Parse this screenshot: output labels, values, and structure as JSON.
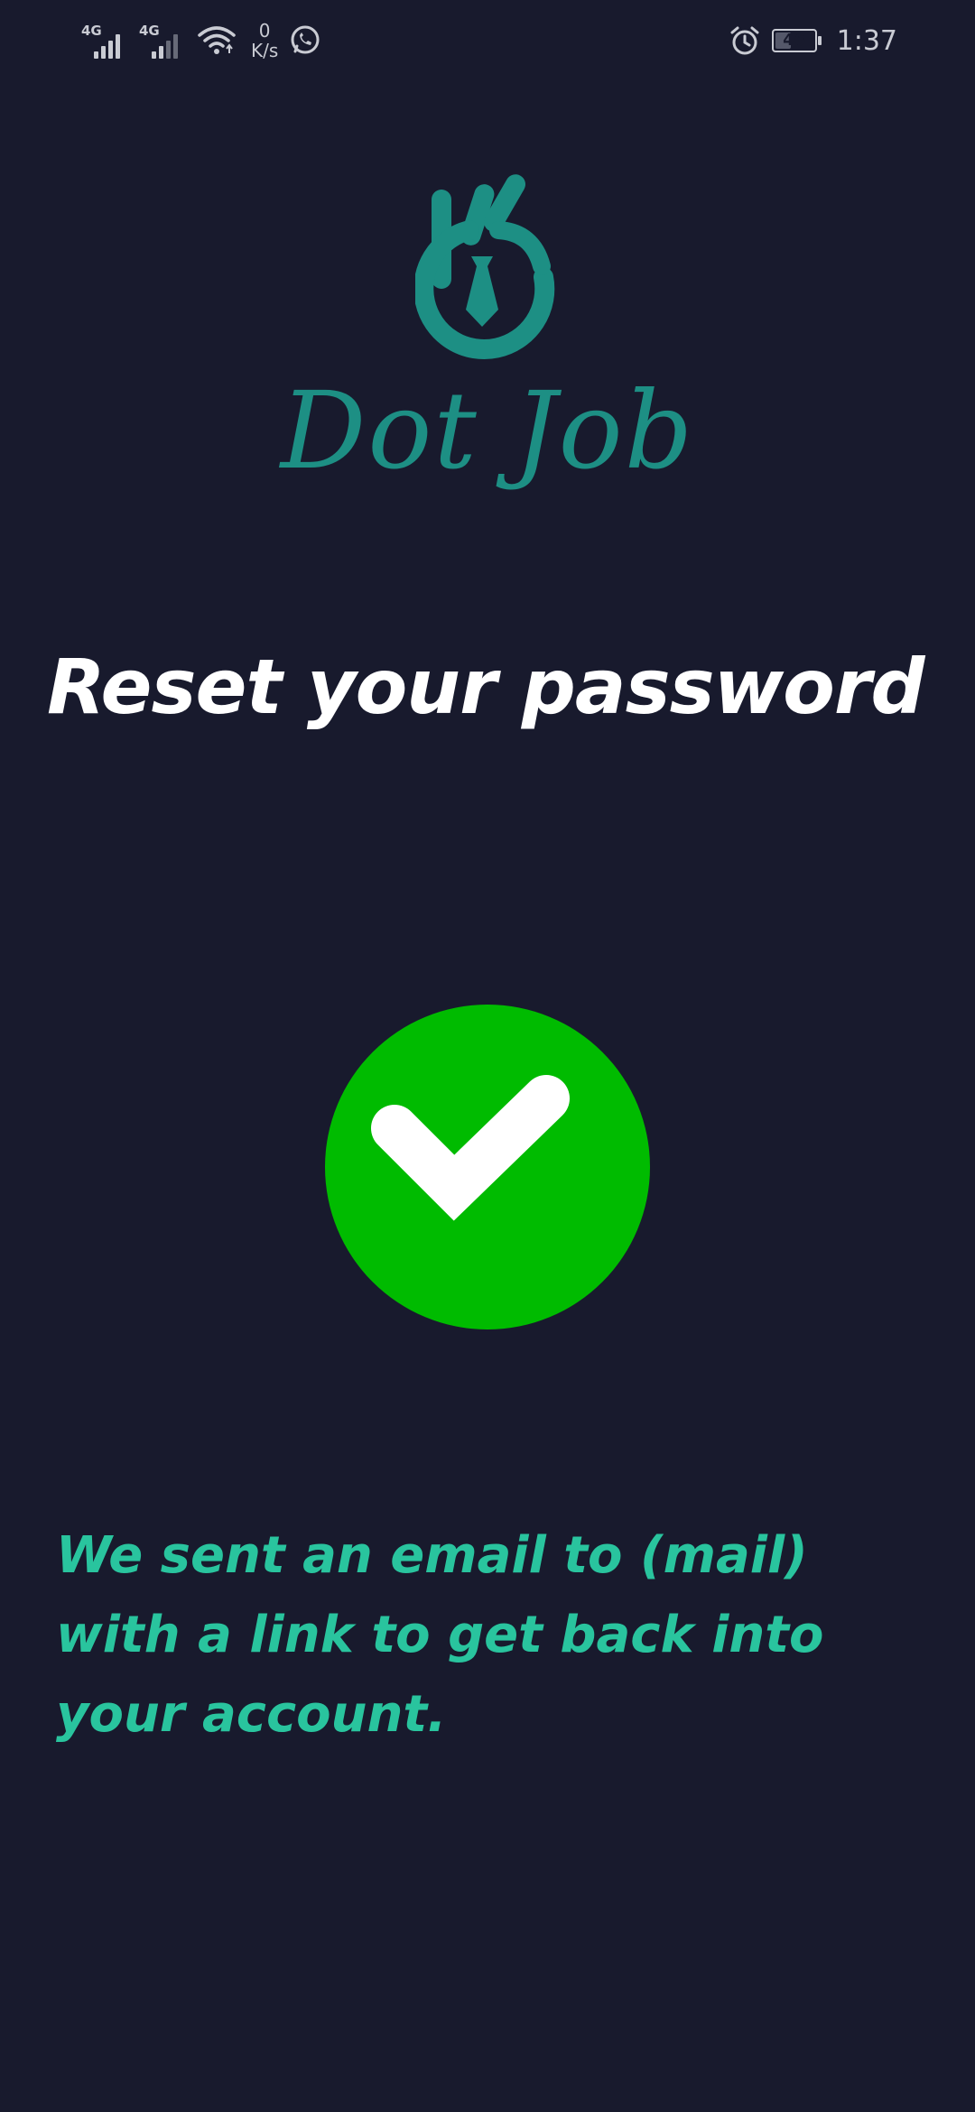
{
  "status_bar": {
    "network1_label": "4G",
    "network2_label": "4G",
    "net_speed_value": "0",
    "net_speed_unit": "K/s",
    "battery_level": "46",
    "time": "1:37",
    "icons": [
      "signal-icon",
      "signal-icon",
      "wifi-icon",
      "whatsapp-icon",
      "alarm-icon",
      "battery-icon"
    ]
  },
  "logo": {
    "text": "Dot Job",
    "color": "#1d8f84"
  },
  "title": "Reset your password",
  "success_icon": {
    "name": "check-circle-icon",
    "color": "#00bb00"
  },
  "message": "We sent an email to (mail) with a link to get back into your account.",
  "colors": {
    "background": "#181a2d",
    "title": "#ffffff",
    "message": "#29c49e",
    "brand": "#1d8f84",
    "success": "#00bb00"
  }
}
